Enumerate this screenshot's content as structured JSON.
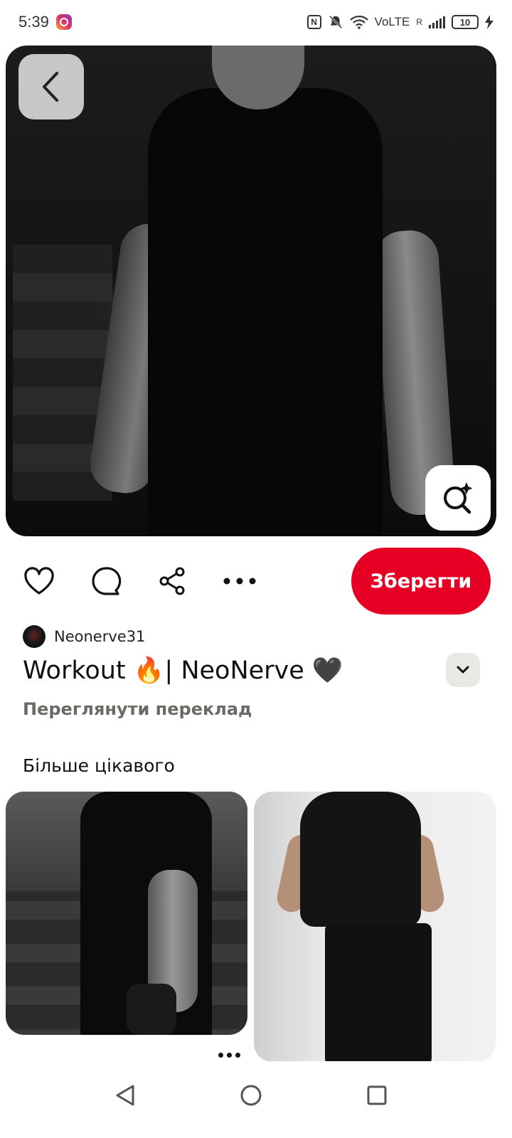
{
  "status_bar": {
    "time": "5:39",
    "app_notification_icon": "instagram-icon",
    "network": "VoLTE",
    "roaming": "R",
    "battery": "10"
  },
  "pin": {
    "author": "Neonerve31",
    "title": "Workout 🔥| NeoNerve 🖤",
    "translate_link": "Переглянути переклад",
    "save_label": "Зберегти"
  },
  "more_section": {
    "heading": "Більше цікавого"
  },
  "icons": {
    "back": "chevron-left-icon",
    "visual_search": "lens-sparkle-icon",
    "like": "heart-icon",
    "comment": "comment-bubble-icon",
    "share": "share-icon",
    "more": "more-dots-icon",
    "expand": "chevron-down-icon"
  },
  "colors": {
    "save_button": "#e60023",
    "expand_bg": "#e9e9e4",
    "translate_text": "#6b6b66"
  }
}
